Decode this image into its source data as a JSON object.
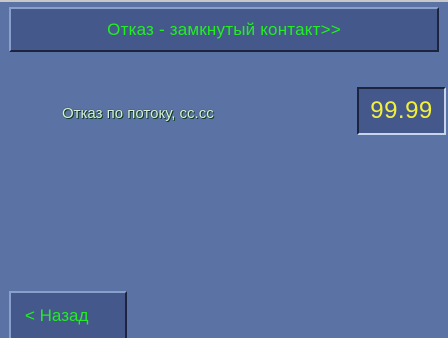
{
  "header": {
    "title": "Отказ - замкнутый контакт>>"
  },
  "setting": {
    "label": "Отказ по потоку, сс.сс",
    "value": "99.99"
  },
  "footer": {
    "back_label": "< Назад"
  },
  "colors": {
    "background": "#5a73a4",
    "panel": "#44588c",
    "title_text": "#22ee22",
    "value_text": "#f2f03a"
  }
}
